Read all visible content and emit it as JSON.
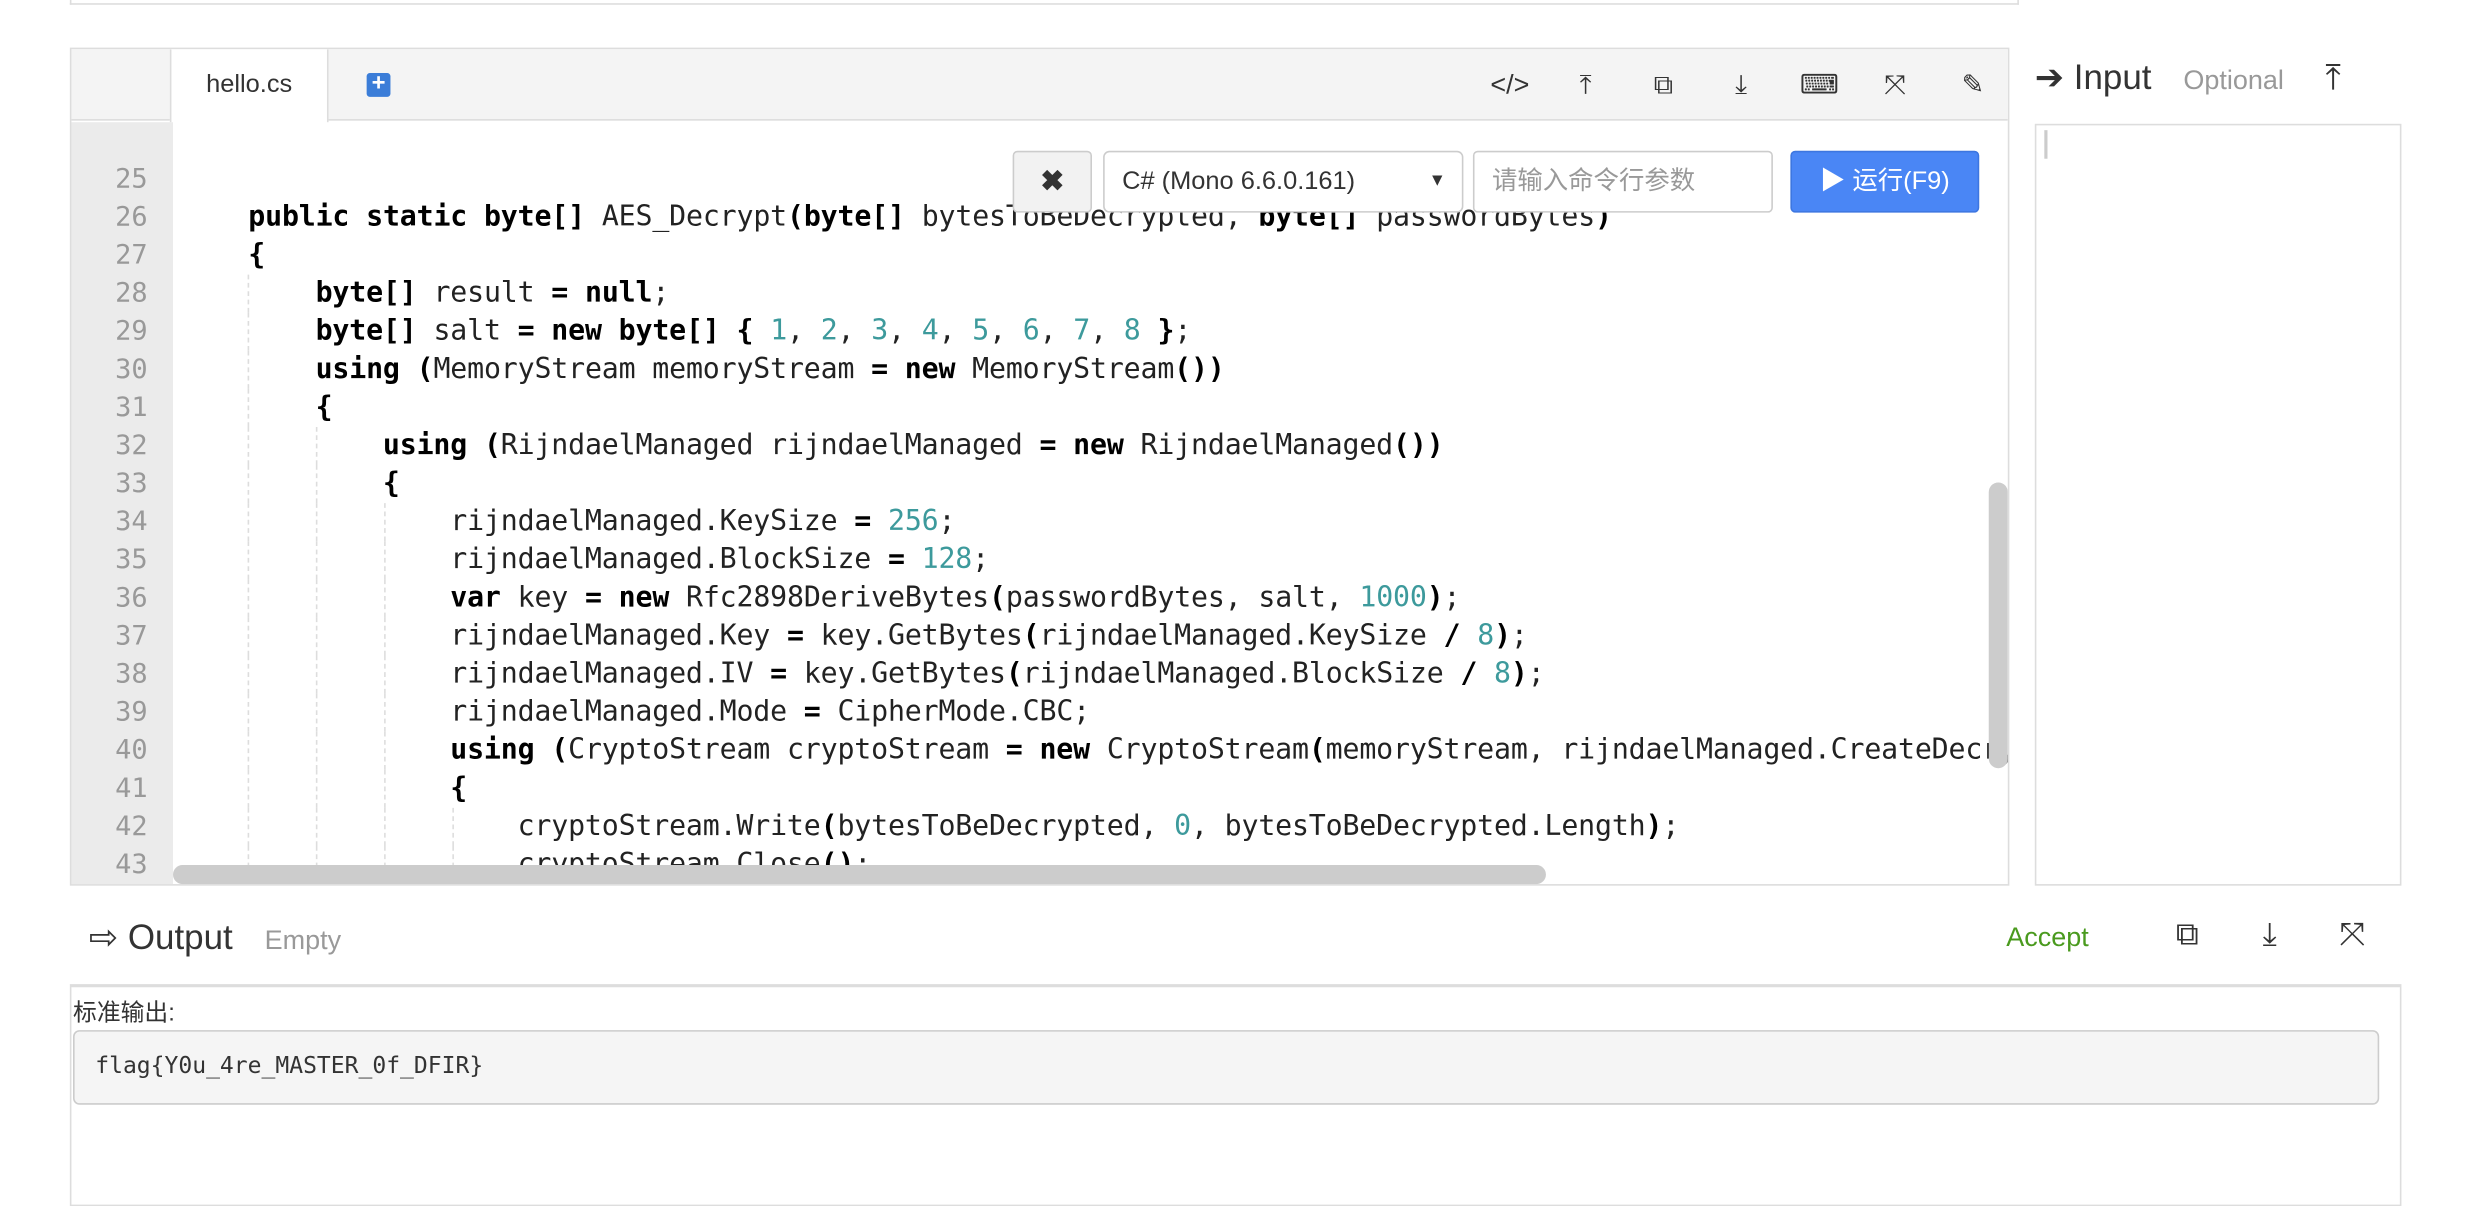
{
  "editor": {
    "tab": "hello.cs",
    "toolbar": [
      {
        "icon": "code-icon",
        "glyph": "</>"
      },
      {
        "icon": "upload-icon",
        "glyph": "⤒"
      },
      {
        "icon": "copy-icon",
        "glyph": "⧉"
      },
      {
        "icon": "download-icon",
        "glyph": "⤓"
      },
      {
        "icon": "keyboard-icon",
        "glyph": "⌨"
      },
      {
        "icon": "fullscreen-icon",
        "glyph": "⤧"
      },
      {
        "icon": "edit-icon",
        "glyph": "✎"
      }
    ],
    "first_line": 25,
    "lines": [
      "",
      "    public static byte[] AES_Decrypt(byte[] bytesToBeDecrypted, byte[] passwordBytes)",
      "    {",
      "        byte[] result = null;",
      "        byte[] salt = new byte[] { 1, 2, 3, 4, 5, 6, 7, 8 };",
      "        using (MemoryStream memoryStream = new MemoryStream())",
      "        {",
      "            using (RijndaelManaged rijndaelManaged = new RijndaelManaged())",
      "            {",
      "                rijndaelManaged.KeySize = 256;",
      "                rijndaelManaged.BlockSize = 128;",
      "                var key = new Rfc2898DeriveBytes(passwordBytes, salt, 1000);",
      "                rijndaelManaged.Key = key.GetBytes(rijndaelManaged.KeySize / 8);",
      "                rijndaelManaged.IV = key.GetBytes(rijndaelManaged.BlockSize / 8);",
      "                rijndaelManaged.Mode = CipherMode.CBC;",
      "                using (CryptoStream cryptoStream = new CryptoStream(memoryStream, rijndaelManaged.CreateDecryptor(), CryptoStreamMode.Write))",
      "                {",
      "                    cryptoStream.Write(bytesToBeDecrypted, 0, bytesToBeDecrypted.Length);",
      "                    cryptoStream.Close();",
      "                }"
    ],
    "keywords": [
      "public",
      "static",
      "byte",
      "using",
      "new",
      "var",
      "null"
    ]
  },
  "runbar": {
    "close_icon": "✖",
    "language": "C# (Mono 6.6.0.161)",
    "args_placeholder": "请输入命令行参数",
    "run_label": "▶ 运行(F9)",
    "run_color": "#4a86f5"
  },
  "input": {
    "title": "Input",
    "hint": "Optional",
    "icon_glyph": "➔",
    "upload_glyph": "⤒"
  },
  "output": {
    "title": "Output",
    "hint": "Empty",
    "icon_glyph": "⇨",
    "accept": "Accept",
    "accept_color": "#4a9a1e",
    "icons": [
      {
        "icon": "copy-icon",
        "glyph": "⧉"
      },
      {
        "icon": "download-icon",
        "glyph": "⤓"
      },
      {
        "icon": "fullscreen-icon",
        "glyph": "⤧"
      }
    ],
    "stdout_label": "标准输出:",
    "stdout": "flag{Y0u_4re_MASTER_0f_DFIR}"
  }
}
